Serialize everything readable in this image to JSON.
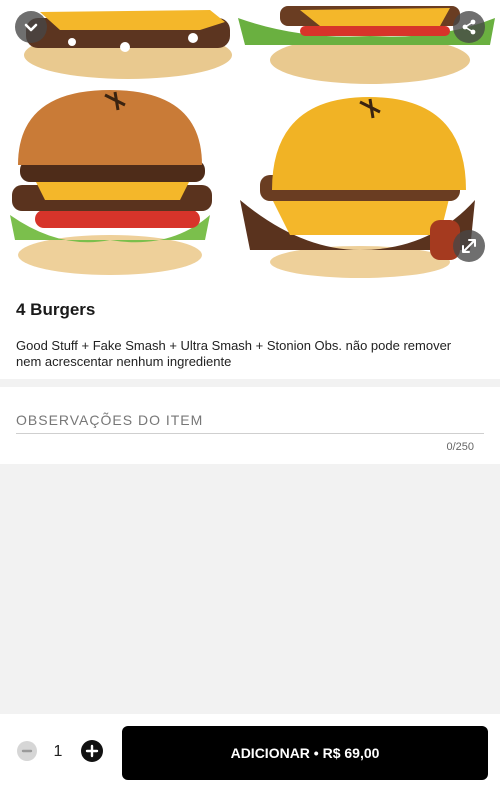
{
  "product": {
    "image_alt": "Four burgers",
    "title": "4 Burgers",
    "description": "Good Stuff + Fake Smash + Ultra Smash + Stonion Obs. não pode remover nem acrescentar nenhum ingrediente"
  },
  "icons": {
    "collapse": "chevron-down-icon",
    "share": "share-icon",
    "expand": "expand-icon",
    "minus": "minus-icon",
    "plus": "plus-icon"
  },
  "notes": {
    "label": "OBSERVAÇÕES DO ITEM",
    "placeholder": "",
    "counter": "0/250"
  },
  "footer": {
    "quantity": "1",
    "add_label": "ADICIONAR • R$ 69,00"
  },
  "colors": {
    "accent": "#000000",
    "background": "#f2f2f2"
  }
}
